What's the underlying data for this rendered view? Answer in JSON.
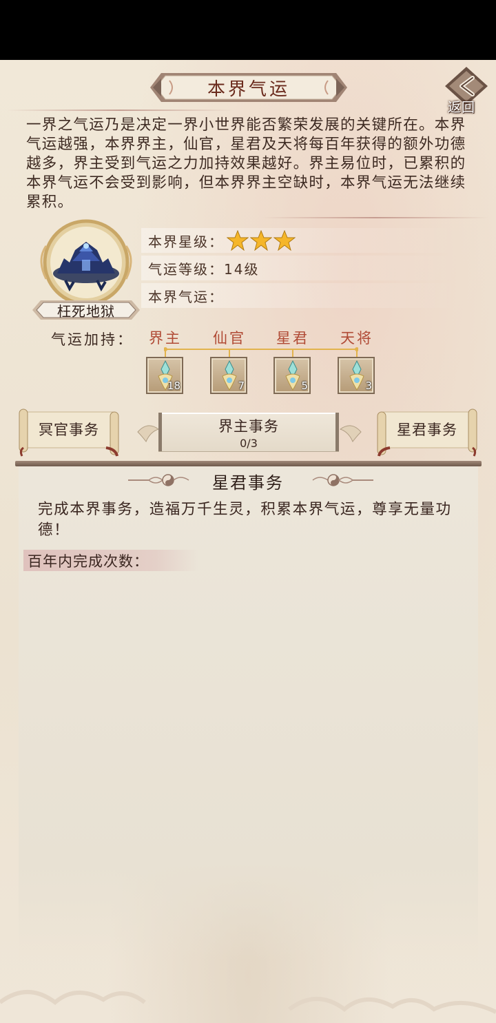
{
  "header": {
    "title": "本界气运",
    "back_label": "返回"
  },
  "description": "一界之气运乃是决定一界小世界能否繁荣发展的关键所在。本界气运越强，本界界主，仙官，星君及天将每百年获得的额外功德越多，界主受到气运之力加持效果越好。界主易位时，已累积的本界气运不会受到影响，但本界界主空缺时，本界气运无法继续累积。",
  "realm": {
    "name": "枉死地狱",
    "star_label": "本界星级：",
    "stars": 3,
    "level_label": "气运等级：",
    "level_value": "14级",
    "fortune_label": "本界气运：",
    "fortune_value": ""
  },
  "bonus": {
    "label": "气运加持：",
    "roles": [
      {
        "name": "界主",
        "count": "18"
      },
      {
        "name": "仙官",
        "count": "7"
      },
      {
        "name": "星君",
        "count": "5"
      },
      {
        "name": "天将",
        "count": "3"
      }
    ]
  },
  "tabs": {
    "left": "冥官事务",
    "center": {
      "label": "界主事务",
      "count": "0/3"
    },
    "right": "星君事务"
  },
  "panel": {
    "title": "星君事务",
    "desc": "完成本界事务，造福万千生灵，积累本界气运，尊享无量功德！",
    "count_label": "百年内完成次数："
  },
  "colors": {
    "accent_red": "#b04a35",
    "title_red": "#6a2a1c",
    "star_gold": "#f5b62a",
    "text_brown": "#3d2a22"
  }
}
